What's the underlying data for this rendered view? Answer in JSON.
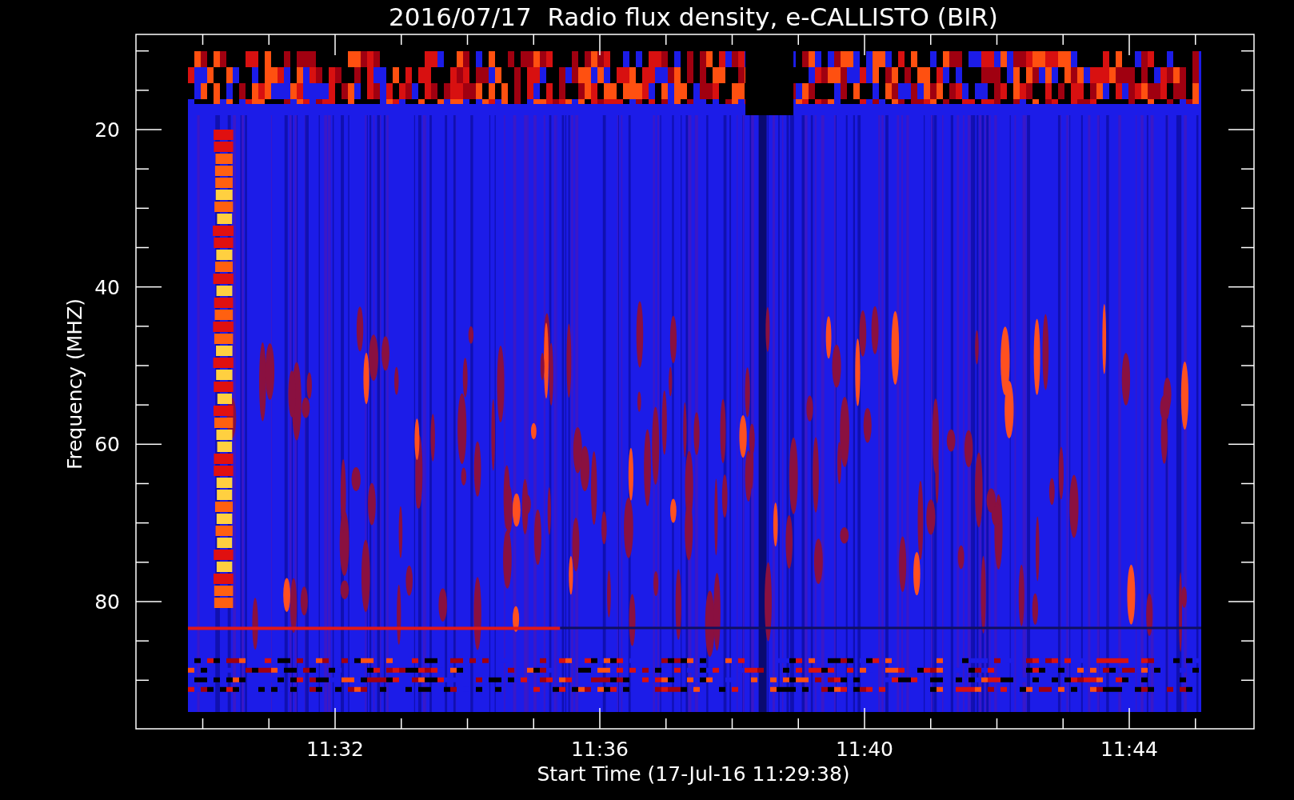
{
  "plot": {
    "title": "2016/07/17  Radio flux density, e-CALLISTO (BIR)",
    "xlabel": "Start Time (17-Jul-16 11:29:38)",
    "ylabel": "Frequency (MHZ)",
    "yticks": [
      "20",
      "40",
      "60",
      "80"
    ],
    "xticks": [
      "11:32",
      "11:36",
      "11:40",
      "11:44"
    ]
  }
}
